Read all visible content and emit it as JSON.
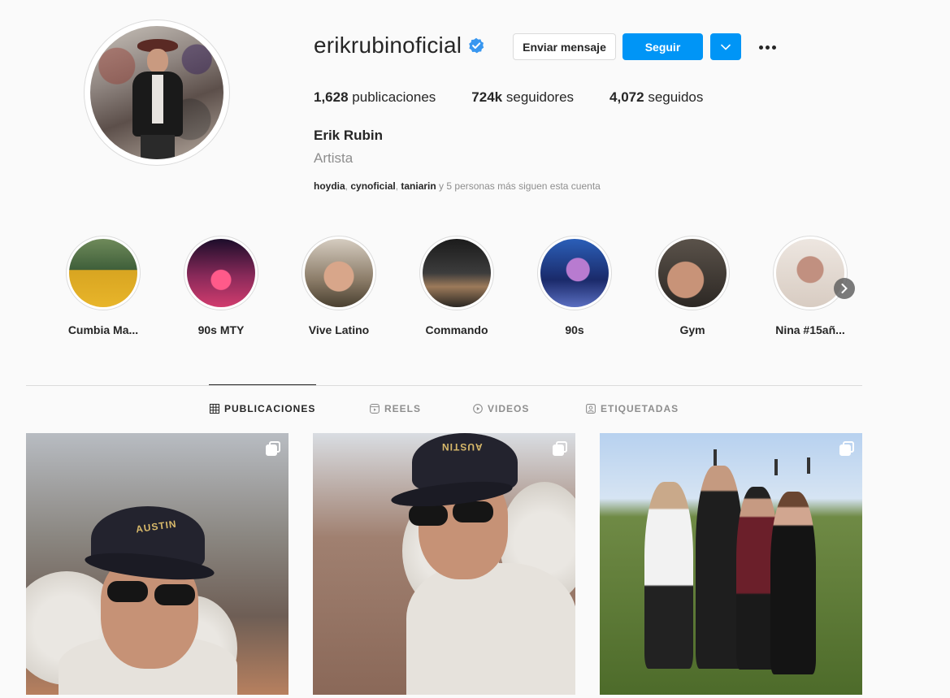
{
  "profile": {
    "username": "erikrubinoficial",
    "verified": true,
    "buttons": {
      "message": "Enviar mensaje",
      "follow": "Seguir"
    },
    "stats": {
      "posts_count": "1,628",
      "posts_label": "publicaciones",
      "followers_count": "724k",
      "followers_label": "seguidores",
      "following_count": "4,072",
      "following_label": "seguidos"
    },
    "full_name": "Erik Rubin",
    "category": "Artista",
    "followed_by": {
      "users": [
        "hoydia",
        "cynoficial",
        "taniarin"
      ],
      "separator": ", ",
      "suffix": " y 5 personas más siguen esta cuenta"
    }
  },
  "highlights": [
    {
      "label": "Cumbia Ma..."
    },
    {
      "label": "90s MTY"
    },
    {
      "label": "Vive Latino"
    },
    {
      "label": "Commando"
    },
    {
      "label": "90s"
    },
    {
      "label": "Gym"
    },
    {
      "label": "Nina #15añ..."
    }
  ],
  "tabs": [
    {
      "label": "PUBLICACIONES",
      "icon": "grid-icon",
      "active": true
    },
    {
      "label": "REELS",
      "icon": "reels-icon",
      "active": false
    },
    {
      "label": "VIDEOS",
      "icon": "video-play-icon",
      "active": false
    },
    {
      "label": "ETIQUETADAS",
      "icon": "tagged-user-icon",
      "active": false
    }
  ],
  "posts": [
    {
      "type": "carousel",
      "cap_text": "AUSTIN"
    },
    {
      "type": "carousel",
      "cap_text": "AUSTIN"
    },
    {
      "type": "carousel"
    }
  ],
  "colors": {
    "accent": "#0095f6",
    "verified": "#3897f0",
    "text": "#262626",
    "muted": "#8e8e8e",
    "border": "#dbdbdb",
    "background": "#fafafa"
  }
}
